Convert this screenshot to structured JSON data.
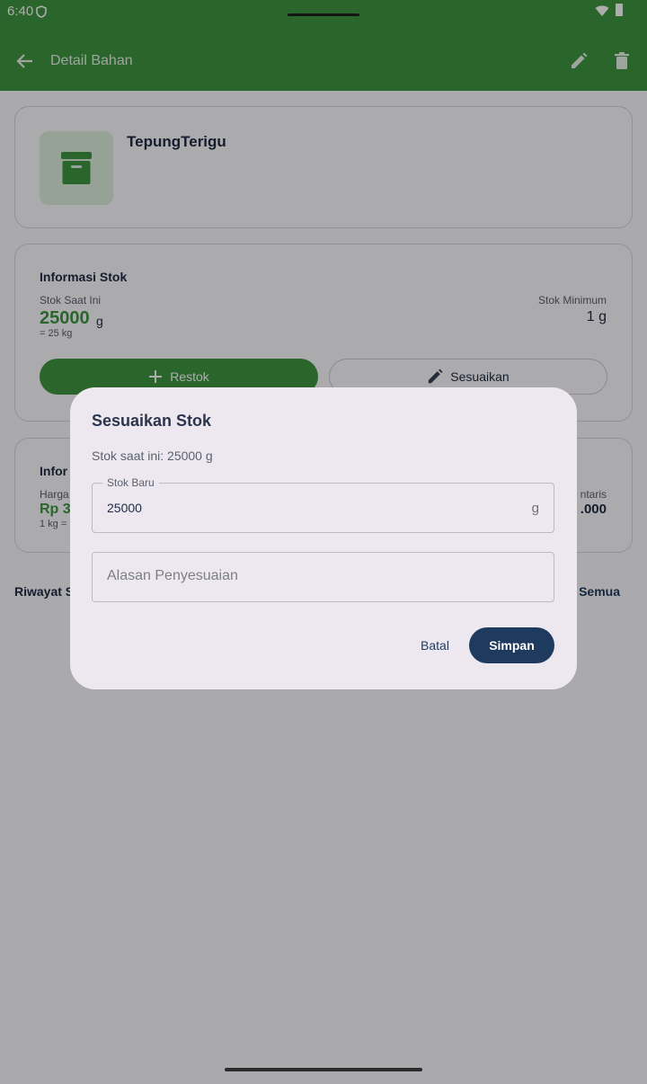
{
  "status_bar": {
    "time": "6:40"
  },
  "app_bar": {
    "title": "Detail Bahan"
  },
  "item": {
    "name": "TepungTerigu"
  },
  "stock_card": {
    "title": "Informasi Stok",
    "current_label": "Stok Saat Ini",
    "current_value": "25000",
    "current_unit": "g",
    "conversion": "= 25 kg",
    "minimum_label": "Stok Minimum",
    "minimum_value": "1 g",
    "restock_label": "Restok",
    "adjust_label": "Sesuaikan"
  },
  "info_card": {
    "title": "Infor",
    "price_label": "Harga",
    "price_value": "Rp 3",
    "price_sub": "1 kg =",
    "value_label": "ntaris",
    "value_amount": ".000"
  },
  "history": {
    "title": "Riwayat S",
    "link": "t Semua"
  },
  "dialog": {
    "title": "Sesuaikan Stok",
    "current_text": "Stok saat ini: 25000 g",
    "new_stock_label": "Stok Baru",
    "new_stock_value": "25000",
    "new_stock_suffix": "g",
    "reason_placeholder": "Alasan Penyesuaian",
    "cancel_label": "Batal",
    "save_label": "Simpan"
  },
  "colors": {
    "primary_green": "#3e9642",
    "navy": "#1f3a5f",
    "dialog_bg": "#ede8ef"
  }
}
